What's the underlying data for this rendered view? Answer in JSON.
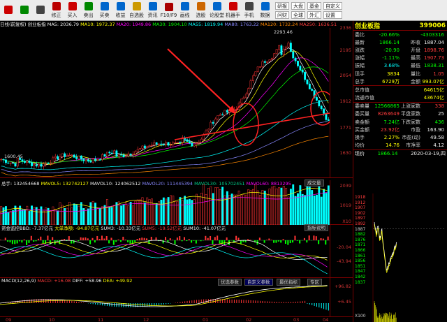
{
  "toolbar": {
    "buttons": [
      {
        "icon": "back-icon",
        "label": "",
        "color": "#c00"
      },
      {
        "icon": "forward-icon",
        "label": "",
        "color": "#080"
      },
      {
        "icon": "square-icon",
        "label": "",
        "color": "#444"
      },
      {
        "icon": "edit-icon",
        "label": "修正",
        "color": "#b00"
      },
      {
        "icon": "buy-icon",
        "label": "买入",
        "color": "#c00"
      },
      {
        "icon": "sell-icon",
        "label": "卖出",
        "color": "#080"
      },
      {
        "icon": "credit-buy-icon",
        "label": "买卖",
        "color": "#06c"
      },
      {
        "icon": "page-icon",
        "label": "收益",
        "color": "#06c"
      },
      {
        "icon": "star-icon",
        "label": "自选股",
        "color": "#c90"
      },
      {
        "icon": "news-icon",
        "label": "资讯",
        "color": "#06c"
      },
      {
        "icon": "f10-icon",
        "label": "F10/F9",
        "color": "#a00"
      },
      {
        "icon": "screen-icon",
        "label": "画线",
        "color": "#06c"
      },
      {
        "icon": "filter-icon",
        "label": "选股",
        "color": "#c60"
      },
      {
        "icon": "forum-icon",
        "label": "论股堂",
        "color": "#06c"
      },
      {
        "icon": "robot-icon",
        "label": "机器手",
        "color": "#c00"
      },
      {
        "icon": "phone-icon",
        "label": "手机",
        "color": "#444"
      },
      {
        "icon": "info-icon",
        "label": "数据",
        "color": "#06c"
      }
    ],
    "drop1": [
      "研报",
      "问财"
    ],
    "drop2": [
      "大盘",
      "全球"
    ],
    "drop3": [
      "基金",
      "外汇"
    ],
    "drop4": [
      "自定义",
      "设置"
    ]
  },
  "ticker": {
    "prefix": "日线(前复权) 创业板指",
    "ma5": "MA5: 2036.79",
    "ma10": "MA10: 1972.37",
    "ma20": "MA20: 1949.86",
    "ma30": "MA30: 1904.10",
    "ma55": "MA55: 1819.94",
    "ma80": "MA80: 1763.22",
    "ma120": "MA120: 1732.24",
    "ma250": "MA250: 1636.51"
  },
  "price_axis": [
    "2336",
    "2195",
    "2054",
    "1912",
    "1771",
    "1630"
  ],
  "price_labels": {
    "high": "2293.46",
    "low": "1600.45"
  },
  "volume": {
    "title_a": "总手: 132454668",
    "title_b": "MAVOL5: 132742127",
    "title_c": "MAVOL10: 124062512",
    "title_d": "MAVOL20: 111445394",
    "title_e": "MAVOL30: 105702451",
    "title_f": "MAVOL60: 8813295",
    "button": "成交量",
    "axis": [
      "2039",
      "1019",
      "X10"
    ]
  },
  "dde": {
    "title_a": "资金监控BBD: -7.37亿元",
    "title_b": "大单净额: -94.87亿元",
    "title_c": "SUM3: -10.33亿元",
    "title_d": "SUM5: -19.52亿元",
    "title_e": "SUM10: -41.07亿元",
    "button": "指标说明",
    "axis": [
      "-20.04",
      "-43.94"
    ]
  },
  "macd": {
    "title_a": "MACD(12,26,9)",
    "title_b": "MACD: +16.08",
    "title_c": "DIFF: +58.96",
    "title_d": "DEA: +49.92",
    "tabs": [
      "优选参数",
      "自定义参数",
      "最优指标",
      "专区"
    ],
    "axis": [
      "+96.82",
      "+6.45"
    ]
  },
  "xaxis": [
    "09",
    "10",
    "11",
    "12",
    "01",
    "02",
    "03",
    "04"
  ],
  "quote": {
    "name": "创业板指",
    "code": "399006",
    "rows": [
      {
        "l": "委比",
        "v1": "-20.66%",
        "l2": "",
        "v2": "-4303316",
        "c1": "grn",
        "c2": "grn"
      },
      {
        "l": "最新",
        "v1": "1866.14",
        "l2": "昨收",
        "v2": "1887.04",
        "c1": "grn",
        "c2": "wht"
      },
      {
        "l": "涨跌",
        "v1": "-20.90",
        "l2": "开盘",
        "v2": "1898.76",
        "c1": "grn",
        "c2": "red"
      },
      {
        "l": "涨幅",
        "v1": "-1.11%",
        "l2": "最高",
        "v2": "1907.73",
        "c1": "grn",
        "c2": "red"
      },
      {
        "l": "振幅",
        "v1": "3.68%",
        "l2": "最低",
        "v2": "1838.31",
        "c1": "cyn",
        "c2": "grn"
      },
      {
        "l": "现手",
        "v1": "3834",
        "l2": "量比",
        "v2": "1.05",
        "c1": "yel",
        "c2": "red"
      },
      {
        "l": "总手",
        "v1": "6729万",
        "l2": "金额",
        "v2": "993.07亿",
        "c1": "yel",
        "c2": "yel"
      }
    ],
    "rows2": [
      {
        "l": "总市值",
        "v1": "",
        "l2": "",
        "v2": "64615亿",
        "c1": "wht",
        "c2": "yel"
      },
      {
        "l": "流通市值",
        "v1": "",
        "l2": "",
        "v2": "43674亿",
        "c1": "wht",
        "c2": "yel"
      }
    ],
    "rows3": [
      {
        "l": "委卖量",
        "v1": "12566865",
        "l2": "上涨家数",
        "v2": "338",
        "c1": "grn",
        "c2": "red"
      },
      {
        "l": "委买量",
        "v1": "8263649",
        "l2": "平盘家数",
        "v2": "25",
        "c1": "red",
        "c2": "wht"
      },
      {
        "l": "卖金额",
        "v1": "7.24亿",
        "l2": "下跌家数",
        "v2": "436",
        "c1": "grn",
        "c2": "grn"
      },
      {
        "l": "买金额",
        "v1": "23.92亿",
        "l2": "市盈",
        "v2": "163.90",
        "c1": "red",
        "c2": "wht"
      },
      {
        "l": "换手",
        "v1": "2.27%",
        "l2": "市盈(动)",
        "v2": "49.58",
        "c1": "yel",
        "c2": "wht"
      },
      {
        "l": "均价",
        "v1": "14.76",
        "l2": "市净率",
        "v2": "4.12",
        "c1": "yel",
        "c2": "wht"
      }
    ],
    "mini_header": {
      "label": "现价",
      "price": "1866.14",
      "date": "2020-03-19,四"
    },
    "mini_axis": [
      "1918",
      "1912",
      "1907",
      "1902",
      "1897",
      "1892",
      "1887",
      "1882",
      "1876",
      "1871",
      "1866",
      "1861",
      "1856",
      "1851",
      "1847",
      "1842",
      "1837"
    ],
    "mini_vol": "X100"
  }
}
